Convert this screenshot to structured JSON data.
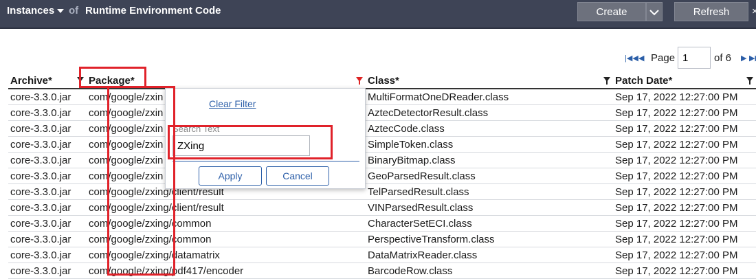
{
  "header": {
    "instances_label": "Instances",
    "of_label": "of",
    "title": "Runtime Environment Code",
    "create_label": "Create",
    "refresh_label": "Refresh"
  },
  "pager": {
    "page_label": "Page",
    "page_value": "1",
    "of_total": "of 6"
  },
  "table": {
    "columns": [
      "Archive*",
      "Package*",
      "Class*",
      "Patch Date*"
    ],
    "rows": [
      {
        "archive": "core-3.3.0.jar",
        "package": "com/google/zxin",
        "class": "MultiFormatOneDReader.class",
        "date": "Sep 17, 2022 12:27:00 PM"
      },
      {
        "archive": "core-3.3.0.jar",
        "package": "com/google/zxin",
        "class": "AztecDetectorResult.class",
        "date": "Sep 17, 2022 12:27:00 PM"
      },
      {
        "archive": "core-3.3.0.jar",
        "package": "com/google/zxin",
        "class": "AztecCode.class",
        "date": "Sep 17, 2022 12:27:00 PM"
      },
      {
        "archive": "core-3.3.0.jar",
        "package": "com/google/zxin",
        "class": "SimpleToken.class",
        "date": "Sep 17, 2022 12:27:00 PM"
      },
      {
        "archive": "core-3.3.0.jar",
        "package": "com/google/zxin",
        "class": "BinaryBitmap.class",
        "date": "Sep 17, 2022 12:27:00 PM"
      },
      {
        "archive": "core-3.3.0.jar",
        "package": "com/google/zxin",
        "class": "GeoParsedResult.class",
        "date": "Sep 17, 2022 12:27:00 PM"
      },
      {
        "archive": "core-3.3.0.jar",
        "package": "com/google/zxing/client/result",
        "class": "TelParsedResult.class",
        "date": "Sep 17, 2022 12:27:00 PM"
      },
      {
        "archive": "core-3.3.0.jar",
        "package": "com/google/zxing/client/result",
        "class": "VINParsedResult.class",
        "date": "Sep 17, 2022 12:27:00 PM"
      },
      {
        "archive": "core-3.3.0.jar",
        "package": "com/google/zxing/common",
        "class": "CharacterSetECI.class",
        "date": "Sep 17, 2022 12:27:00 PM"
      },
      {
        "archive": "core-3.3.0.jar",
        "package": "com/google/zxing/common",
        "class": "PerspectiveTransform.class",
        "date": "Sep 17, 2022 12:27:00 PM"
      },
      {
        "archive": "core-3.3.0.jar",
        "package": "com/google/zxing/datamatrix",
        "class": "DataMatrixReader.class",
        "date": "Sep 17, 2022 12:27:00 PM"
      },
      {
        "archive": "core-3.3.0.jar",
        "package": "com/google/zxing/pdf417/encoder",
        "class": "BarcodeRow.class",
        "date": "Sep 17, 2022 12:27:00 PM"
      }
    ]
  },
  "filter_popup": {
    "clear_filter": "Clear Filter",
    "search_label": "Search Text",
    "search_value": "ZXing",
    "apply_label": "Apply",
    "cancel_label": "Cancel"
  },
  "colors": {
    "header_bg": "#3e4456",
    "link": "#2b5ea8",
    "highlight": "#e0222a"
  }
}
